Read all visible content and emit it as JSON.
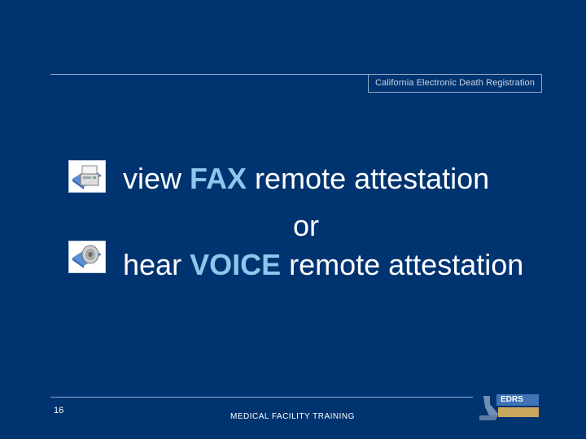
{
  "header": {
    "banner_title": "California Electronic Death Registration"
  },
  "main": {
    "line1": {
      "prefix": "view ",
      "highlight": "FAX",
      "suffix": " remote attestation"
    },
    "line2": {
      "text": "or"
    },
    "line3": {
      "prefix": "hear ",
      "highlight": "VOICE",
      "suffix": " remote attestation"
    },
    "icons": {
      "fax": "fax-icon",
      "voice": "speaker-icon"
    }
  },
  "footer": {
    "page_number": "16",
    "title": "MEDICAL FACILITY TRAINING",
    "logo_text": "EDRS"
  },
  "colors": {
    "background": "#003470",
    "highlight": "#8ec6ee",
    "text": "#ffffff"
  }
}
